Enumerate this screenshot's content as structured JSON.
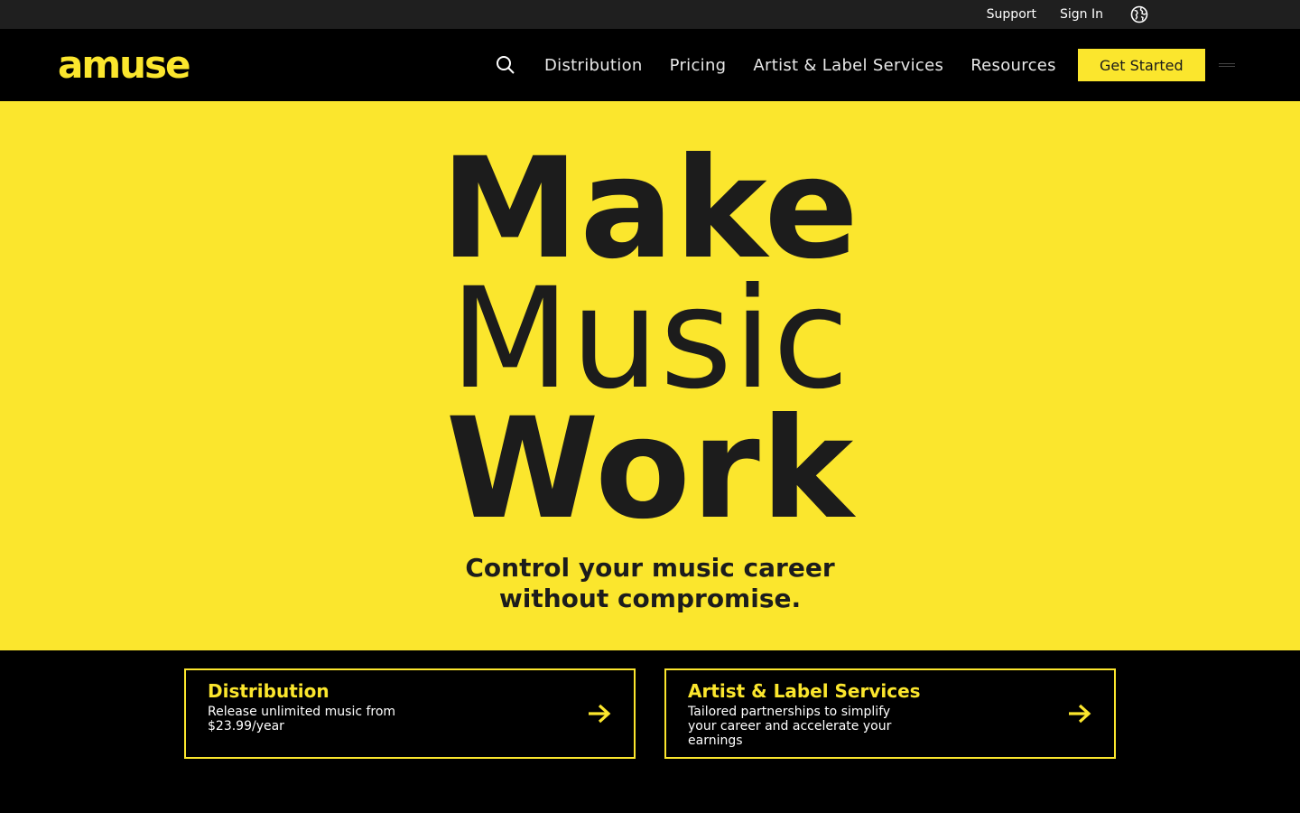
{
  "topbar": {
    "support": "Support",
    "sign_in": "Sign In",
    "globe_icon": "globe-icon"
  },
  "nav": {
    "logo": "amuse",
    "search_icon": "search-icon",
    "links": [
      "Distribution",
      "Pricing",
      "Artist & Label Services",
      "Resources"
    ],
    "cta": "Get Started",
    "menu_icon": "menu-icon"
  },
  "hero": {
    "line1": "Make",
    "line2": "Music",
    "line3": "Work",
    "subtitle_line1": "Control your music career",
    "subtitle_line2": "without compromise."
  },
  "cards": [
    {
      "title": "Distribution",
      "desc_line1": "Release unlimited music from",
      "desc_line2": "$23.99/year",
      "desc_line3": "",
      "icon": "arrow-right-icon"
    },
    {
      "title": "Artist & Label Services",
      "desc_line1": "Tailored partnerships to simplify",
      "desc_line2": "your career and accelerate your",
      "desc_line3": "earnings",
      "icon": "arrow-right-icon"
    }
  ],
  "colors": {
    "accent": "#fbe62d",
    "topbar_bg": "#1f1f1f",
    "nav_bg": "#000000",
    "text_dark": "#1c1c1c"
  }
}
